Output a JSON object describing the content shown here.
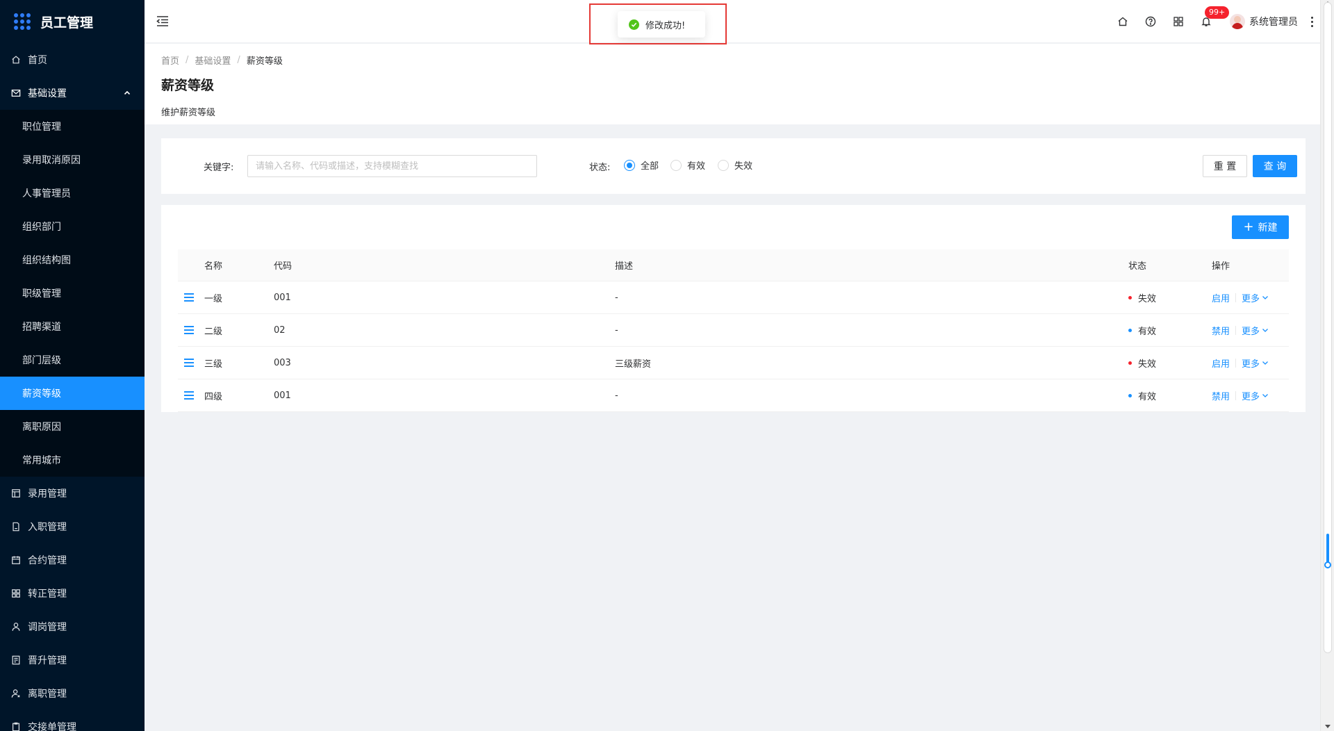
{
  "app": {
    "title": "员工管理"
  },
  "sidebar": {
    "top_items": [
      {
        "label": "首页",
        "icon": "home-icon"
      },
      {
        "label": "基础设置",
        "icon": "mail-icon"
      }
    ],
    "sub_items": [
      {
        "label": "职位管理"
      },
      {
        "label": "录用取消原因"
      },
      {
        "label": "人事管理员"
      },
      {
        "label": "组织部门"
      },
      {
        "label": "组织结构图"
      },
      {
        "label": "职级管理"
      },
      {
        "label": "招聘渠道"
      },
      {
        "label": "部门层级"
      },
      {
        "label": "薪资等级"
      },
      {
        "label": "离职原因"
      },
      {
        "label": "常用城市"
      }
    ],
    "bottom_items": [
      {
        "label": "录用管理",
        "icon": "layout-icon"
      },
      {
        "label": "入职管理",
        "icon": "file-icon"
      },
      {
        "label": "合约管理",
        "icon": "calendar-icon"
      },
      {
        "label": "转正管理",
        "icon": "grid-icon"
      },
      {
        "label": "调岗管理",
        "icon": "user-icon"
      },
      {
        "label": "晋升管理",
        "icon": "document-icon"
      },
      {
        "label": "离职管理",
        "icon": "user-leave-icon"
      },
      {
        "label": "交接单管理",
        "icon": "clipboard-icon"
      }
    ]
  },
  "header": {
    "badge": "99+",
    "user_name": "系统管理员"
  },
  "toast": {
    "message": "修改成功!"
  },
  "breadcrumb": {
    "home": "首页",
    "parent": "基础设置",
    "current": "薪资等级"
  },
  "page": {
    "title": "薪资等级",
    "description": "维护薪资等级"
  },
  "search": {
    "keyword_label": "关键字:",
    "keyword_value": "",
    "keyword_placeholder": "请输入名称、代码或描述，支持模糊查找",
    "status_label": "状态:",
    "status_options": [
      "全部",
      "有效",
      "失效"
    ],
    "status_selected": "全部",
    "reset_label": "重 置",
    "query_label": "查 询"
  },
  "table": {
    "new_label": "新建",
    "headers": {
      "name": "名称",
      "code": "代码",
      "desc": "描述",
      "status": "状态",
      "ops": "操作"
    },
    "rows": [
      {
        "name": "一级",
        "code": "001",
        "desc": "-",
        "status": "失效",
        "status_color": "#f5222d",
        "action": "启用",
        "more": "更多"
      },
      {
        "name": "二级",
        "code": "02",
        "desc": "-",
        "status": "有效",
        "status_color": "#1890ff",
        "action": "禁用",
        "more": "更多"
      },
      {
        "name": "三级",
        "code": "003",
        "desc": "三级薪资",
        "status": "失效",
        "status_color": "#f5222d",
        "action": "启用",
        "more": "更多"
      },
      {
        "name": "四级",
        "code": "001",
        "desc": "-",
        "status": "有效",
        "status_color": "#1890ff",
        "action": "禁用",
        "more": "更多"
      }
    ]
  },
  "colors": {
    "sidebar_bg": "#001529",
    "submenu_bg": "#000c17",
    "primary": "#1890ff",
    "success": "#52c41a",
    "error": "#f5222d"
  }
}
